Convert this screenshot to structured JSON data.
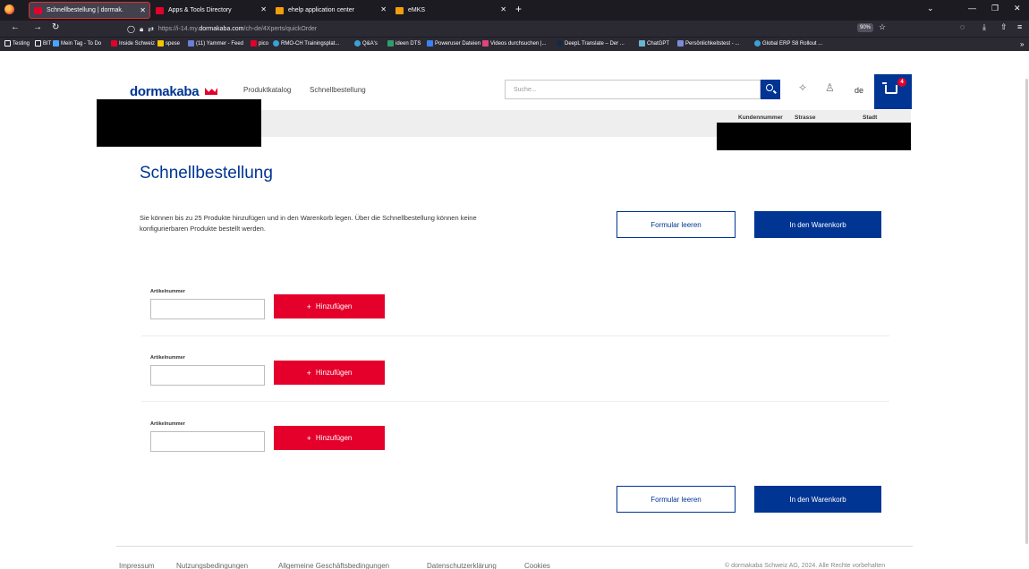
{
  "browser": {
    "tabs": [
      {
        "label": "Schnellbestellung | dormak.",
        "color": "#e4002b"
      },
      {
        "label": "Apps & Tools Directory",
        "color": "#e4002b"
      },
      {
        "label": "ehelp application center",
        "color": "#f59e0b"
      },
      {
        "label": "eMKS",
        "color": "#f59e0b"
      }
    ],
    "url_prefix": "https://i-14.my.",
    "url_host": "dormakaba.com",
    "url_path": "/ch-de/4Xperts/quickOrder",
    "zoom": "90%",
    "bookmarks": [
      "Testing",
      "BIT",
      "Mein Tag - To Do",
      "Inside Schweiz",
      "spese",
      "(11) Yammer - Feed",
      "pico",
      "RMO-CH Trainingsplat...",
      "Q&A's",
      "ideen DTS",
      "Poweruser Dateien",
      "Videos durchsuchen |...",
      "DeepL Translate – Der ...",
      "ChatGPT",
      "Persönlichkeitstest - ...",
      "Global ERP S8 Rollout ..."
    ]
  },
  "header": {
    "logo": "dormakaba",
    "nav": [
      "Produktkatalog",
      "Schnellbestellung"
    ],
    "search_placeholder": "Suche...",
    "lang": "de",
    "cart_count": "4",
    "account_columns": [
      "Kundennummer",
      "Strasse",
      "Stadt"
    ]
  },
  "main": {
    "title": "Schnellbestellung",
    "intro": "Sie können bis zu 25 Produkte hinzufügen und in den Warenkorb legen. Über die Schnellbestellung können keine konfigurierbaren Produkte bestellt werden.",
    "clear_label": "Formular leeren",
    "cart_label": "In den Warenkorb",
    "rows": [
      {
        "label": "Artikelnummer",
        "value": "",
        "add_label": "Hinzufügen"
      },
      {
        "label": "Artikelnummer",
        "value": "",
        "add_label": "Hinzufügen"
      },
      {
        "label": "Artikelnummer",
        "value": "",
        "add_label": "Hinzufügen"
      }
    ]
  },
  "footer": {
    "links": [
      "Impressum",
      "Nutzungsbedingungen",
      "Allgemeine Geschäftsbedingungen",
      "Datenschutzerklärung",
      "Cookies"
    ],
    "copyright": "© dormakaba Schweiz AG, 2024. Alle Rechte vorbehalten"
  }
}
